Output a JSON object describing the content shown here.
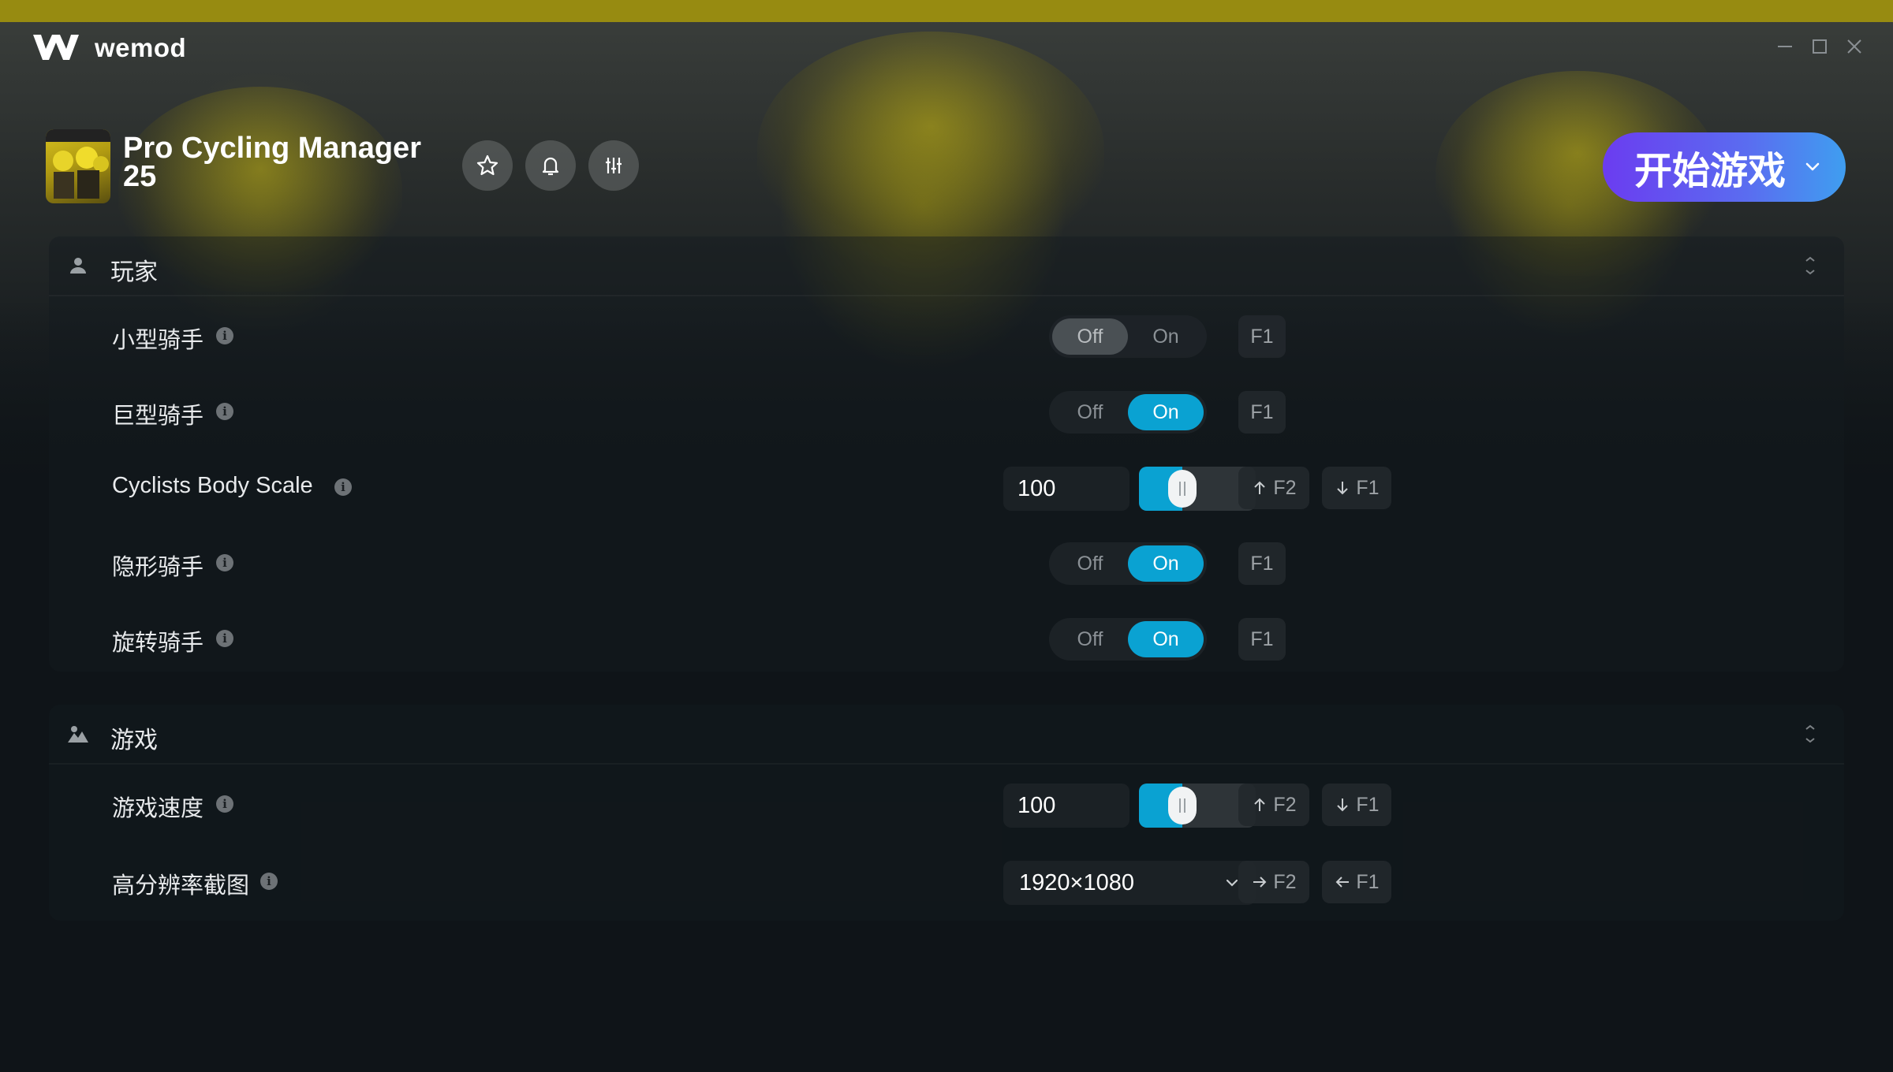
{
  "app": {
    "brand": "wemod"
  },
  "game": {
    "title": "Pro Cycling Manager 25",
    "play_label": "开始游戏"
  },
  "colors": {
    "accent": "#0aa2d2",
    "play_start": "#6b3cf0",
    "play_end": "#3f9ef0",
    "top_bar": "#978b11"
  },
  "sections": {
    "player": {
      "title": "玩家",
      "icon": "person-icon",
      "rows": {
        "small_rider": {
          "label": "小型骑手",
          "off": "Off",
          "on": "On",
          "state": "off",
          "hotkey": "F1"
        },
        "giant_rider": {
          "label": "巨型骑手",
          "off": "Off",
          "on": "On",
          "state": "on",
          "hotkey": "F1"
        },
        "body_scale": {
          "label": "Cyclists Body Scale",
          "value": "100",
          "slider_fraction": 0.33,
          "inc_key": "F2",
          "dec_key": "F1"
        },
        "invisible_rider": {
          "label": "隐形骑手",
          "off": "Off",
          "on": "On",
          "state": "on",
          "hotkey": "F1"
        },
        "spin_rider": {
          "label": "旋转骑手",
          "off": "Off",
          "on": "On",
          "state": "on",
          "hotkey": "F1"
        }
      }
    },
    "game": {
      "title": "游戏",
      "icon": "landscape-icon",
      "rows": {
        "game_speed": {
          "label": "游戏速度",
          "value": "100",
          "slider_fraction": 0.33,
          "inc_key": "F2",
          "dec_key": "F1"
        },
        "hires_screenshot": {
          "label": "高分辨率截图",
          "selected": "1920×1080",
          "next_key": "F2",
          "prev_key": "F1"
        }
      }
    }
  },
  "icons": {
    "favorite": "star-icon",
    "notify": "bell-icon",
    "settings": "sliders-icon",
    "info": "info-icon",
    "collapse": "collapse-icon"
  }
}
